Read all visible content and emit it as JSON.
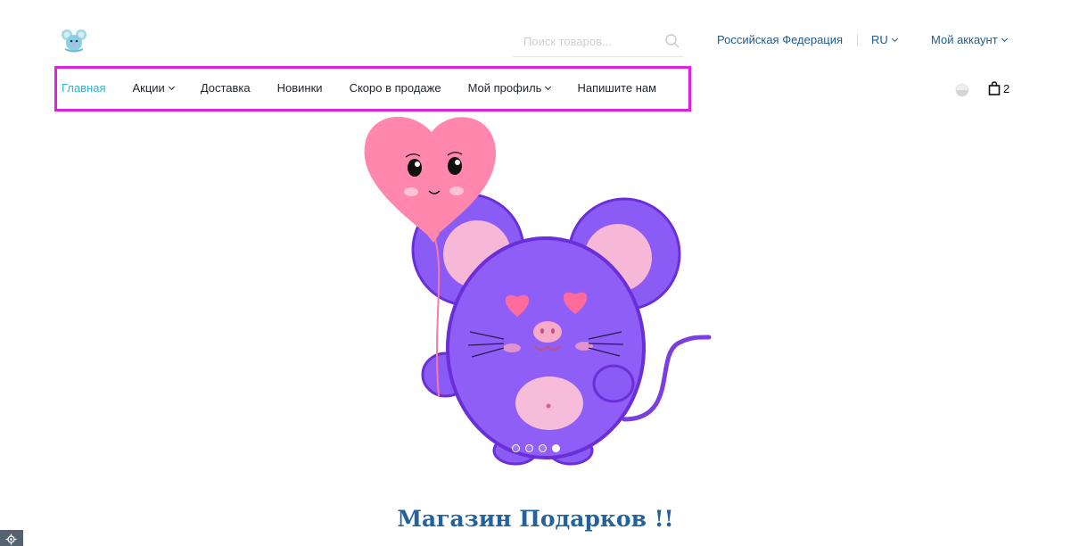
{
  "header": {
    "logo_icon": "mouse-logo-icon",
    "search": {
      "placeholder": "Поиск товаров...",
      "value": "",
      "icon": "search-icon"
    },
    "country": "Российская Федерация",
    "language": "RU",
    "account": "Мой аккаунт"
  },
  "nav": {
    "items": [
      {
        "label": "Главная",
        "active": true,
        "dropdown": false
      },
      {
        "label": "Акции",
        "active": false,
        "dropdown": true
      },
      {
        "label": "Доставка",
        "active": false,
        "dropdown": false
      },
      {
        "label": "Новинки",
        "active": false,
        "dropdown": false
      },
      {
        "label": "Скоро в продаже",
        "active": false,
        "dropdown": false
      },
      {
        "label": "Мой профиль",
        "active": false,
        "dropdown": true
      },
      {
        "label": "Напишите нам",
        "active": false,
        "dropdown": false
      }
    ],
    "highlight_color": "#e020e0",
    "active_color": "#2bb5cf"
  },
  "utility": {
    "theme_icon": "moon-icon",
    "cart_icon": "shopping-bag-icon",
    "cart_count": "2"
  },
  "hero": {
    "image": "purple-mouse-with-heart-balloon",
    "slides": 4,
    "active_slide": 4
  },
  "main": {
    "title": "Магазин Подарков !!"
  },
  "colors": {
    "link": "#1f5b8f",
    "title": "#24629c",
    "mouse": "#8f5ef7",
    "balloon": "#ff7fa8"
  }
}
